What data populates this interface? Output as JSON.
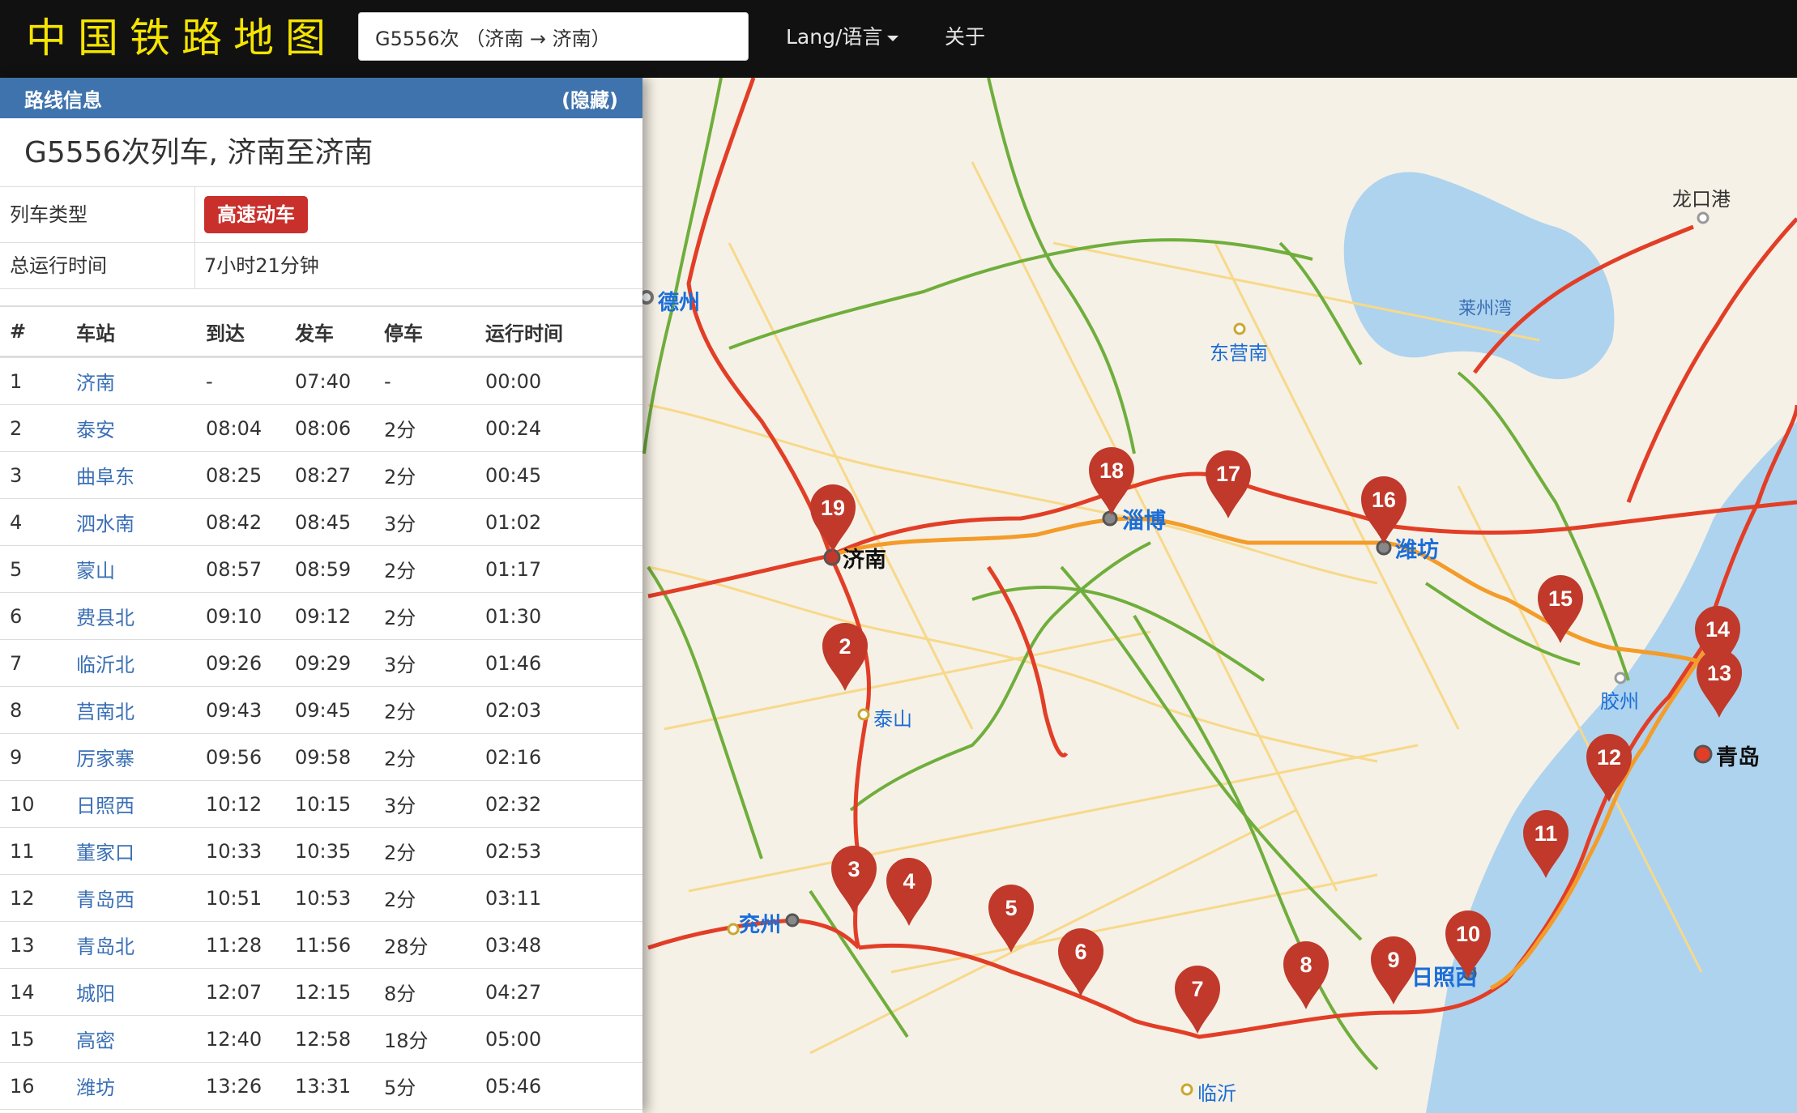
{
  "brand": "中国铁路地图",
  "search": {
    "value": "G5556次 （济南 → 济南）"
  },
  "nav": {
    "lang": "Lang/语言",
    "about": "关于"
  },
  "panel": {
    "header": "路线信息",
    "hide": "(隐藏)",
    "title": "G5556次列车, 济南至济南",
    "train_type_label": "列车类型",
    "train_type": "高速动车",
    "duration_label": "总运行时间",
    "duration": "7小时21分钟"
  },
  "table": {
    "headers": [
      "#",
      "车站",
      "到达",
      "发车",
      "停车",
      "运行时间"
    ],
    "rows": [
      [
        "1",
        "济南",
        "-",
        "07:40",
        "-",
        "00:00"
      ],
      [
        "2",
        "泰安",
        "08:04",
        "08:06",
        "2分",
        "00:24"
      ],
      [
        "3",
        "曲阜东",
        "08:25",
        "08:27",
        "2分",
        "00:45"
      ],
      [
        "4",
        "泗水南",
        "08:42",
        "08:45",
        "3分",
        "01:02"
      ],
      [
        "5",
        "蒙山",
        "08:57",
        "08:59",
        "2分",
        "01:17"
      ],
      [
        "6",
        "费县北",
        "09:10",
        "09:12",
        "2分",
        "01:30"
      ],
      [
        "7",
        "临沂北",
        "09:26",
        "09:29",
        "3分",
        "01:46"
      ],
      [
        "8",
        "莒南北",
        "09:43",
        "09:45",
        "2分",
        "02:03"
      ],
      [
        "9",
        "厉家寨",
        "09:56",
        "09:58",
        "2分",
        "02:16"
      ],
      [
        "10",
        "日照西",
        "10:12",
        "10:15",
        "3分",
        "02:32"
      ],
      [
        "11",
        "董家口",
        "10:33",
        "10:35",
        "2分",
        "02:53"
      ],
      [
        "12",
        "青岛西",
        "10:51",
        "10:53",
        "2分",
        "03:11"
      ],
      [
        "13",
        "青岛北",
        "11:28",
        "11:56",
        "28分",
        "03:48"
      ],
      [
        "14",
        "城阳",
        "12:07",
        "12:15",
        "8分",
        "04:27"
      ],
      [
        "15",
        "高密",
        "12:40",
        "12:58",
        "18分",
        "05:00"
      ],
      [
        "16",
        "潍坊",
        "13:26",
        "13:31",
        "5分",
        "05:46"
      ]
    ]
  },
  "map": {
    "cities": [
      "德州",
      "东营南",
      "龙口港",
      "莱州湾",
      "淄博",
      "济南",
      "潍坊",
      "泰山",
      "胶州",
      "青岛",
      "兖州",
      "日照西",
      "临沂"
    ],
    "markers": [
      "2",
      "3",
      "4",
      "5",
      "6",
      "7",
      "8",
      "9",
      "10",
      "11",
      "12",
      "13",
      "14",
      "15",
      "16",
      "17",
      "18",
      "19"
    ]
  },
  "colors": {
    "navbar": "#111111",
    "brand": "#f5e400",
    "panel_header": "#3f73ad",
    "badge": "#c9302c",
    "marker": "#c0392b",
    "station_link": "#3a6fb5"
  }
}
